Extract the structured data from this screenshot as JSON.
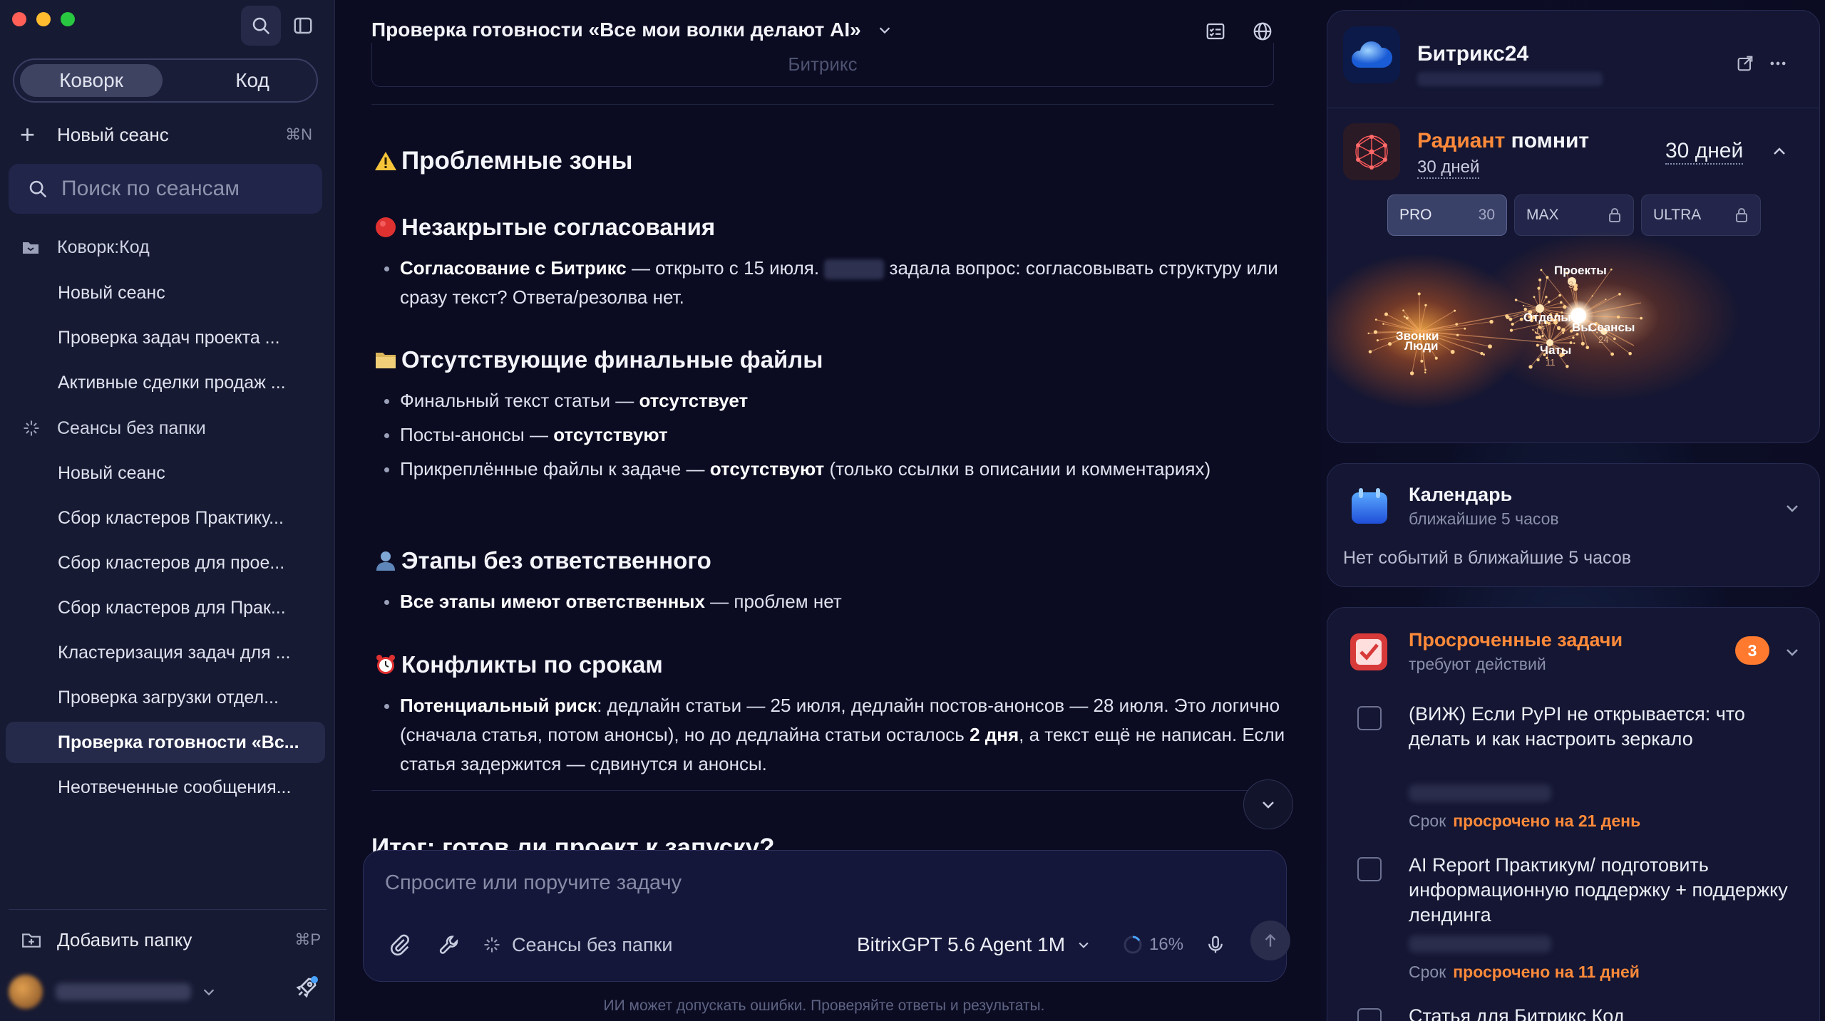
{
  "sidebar": {
    "modes": [
      "Коворк",
      "Код"
    ],
    "new_session": {
      "label": "Новый сеанс",
      "shortcut": "⌘N"
    },
    "search": {
      "placeholder": "Поиск по сеансам"
    },
    "folders": [
      {
        "name": "Коворк:Код",
        "items": [
          "Новый сеанс",
          "Проверка задач проекта ...",
          "Активные сделки продаж ..."
        ]
      },
      {
        "name": "Сеансы без папки",
        "items": [
          "Новый сеанс",
          "Сбор кластеров Практику...",
          "Сбор кластеров для прое...",
          "Сбор кластеров для Прак...",
          "Кластеризация задач для ...",
          "Проверка загрузки отдел...",
          "Проверка готовности «Вс...",
          "Неотвеченные сообщения..."
        ]
      }
    ],
    "active_item": "Проверка готовности «Вс...",
    "add_folder": {
      "label": "Добавить папку",
      "shortcut": "⌘P"
    }
  },
  "main": {
    "title": "Проверка готовности «Все мои волки делают AI»",
    "previous_card_text": "Битрикс",
    "sections": {
      "problem_zones": "Проблемные зоны",
      "unclosed": {
        "heading": "Незакрытые согласования",
        "item_bold": "Согласование с Битрикс",
        "item_text_1": " — открыто с 15 июля. ",
        "item_text_2": " задала вопрос: согласовывать структуру или сразу текст? Ответа/резолва нет."
      },
      "missing_files": {
        "heading": "Отсутствующие финальные файлы",
        "items": [
          {
            "text": "Финальный текст статьи — ",
            "bold": "отсутствует",
            "tail": ""
          },
          {
            "text": "Посты-анонсы — ",
            "bold": "отсутствуют",
            "tail": ""
          },
          {
            "text": "Прикреплённые файлы к задаче — ",
            "bold": "отсутствуют",
            "tail": " (только ссылки в описании и комментариях)"
          }
        ]
      },
      "no_owner": {
        "heading": "Этапы без ответственного",
        "item_bold": "Все этапы имеют ответственных",
        "item_text": " — проблем нет"
      },
      "deadlines": {
        "heading": "Конфликты по срокам",
        "item_bold": "Потенциальный риск",
        "item_text_1": ": дедлайн статьи — 25 июля, дедлайн постов-анонсов — 28 июля. Это логично (сначала статья, потом анонсы), но до дедлайна статьи осталось ",
        "item_bold_2": "2 дня",
        "item_text_2": ", а текст ещё не написан. Если статья задержится — сдвинутся и анонсы."
      },
      "next_heading": "Итог: готов ли проект к запуску?"
    },
    "composer": {
      "placeholder": "Спросите или поручите задачу",
      "folder": "Сеансы без папки",
      "model": "BitrixGPT 5.6 Agent 1M",
      "context_usage": "16%"
    },
    "disclaimer": "ИИ может допускать ошибки. Проверяйте ответы и результаты."
  },
  "right": {
    "bitrix": {
      "title": "Битрикс24"
    },
    "radiant": {
      "title_accent": "Радиант",
      "title_rest": " помнит",
      "days": "30 дней",
      "period": "30 дней",
      "plans": [
        {
          "name": "PRO",
          "count": "30"
        },
        {
          "name": "MAX"
        },
        {
          "name": "ULTRA"
        }
      ],
      "graph_nodes": [
        {
          "label": "Проекты",
          "count": "3"
        },
        {
          "label": "Отделы",
          "count": "17"
        },
        {
          "label": "Вы",
          "count": ""
        },
        {
          "label": "Сеансы",
          "count": "24"
        },
        {
          "label": "Звонки",
          "count": ""
        },
        {
          "label": "Люди",
          "count": ""
        },
        {
          "label": "Чаты",
          "count": "11"
        }
      ]
    },
    "calendar": {
      "title": "Календарь",
      "subtitle": "ближайшие 5 часов",
      "empty": "Нет событий в ближайшие 5 часов"
    },
    "tasks": {
      "title": "Просроченные задачи",
      "subtitle": "требуют действий",
      "badge": "3",
      "due_label": "Срок",
      "items": [
        {
          "title": "(ВИЖ) Если PyPI не открывается: что делать и как настроить зеркало",
          "overdue": "просрочено на 21 день"
        },
        {
          "title": "AI Report Практикум/ подготовить информационную поддержку + поддержку лендинга",
          "overdue": "просрочено на 11 дней"
        },
        {
          "title": "Статья для Битрикс Код",
          "overdue": ""
        }
      ]
    }
  }
}
